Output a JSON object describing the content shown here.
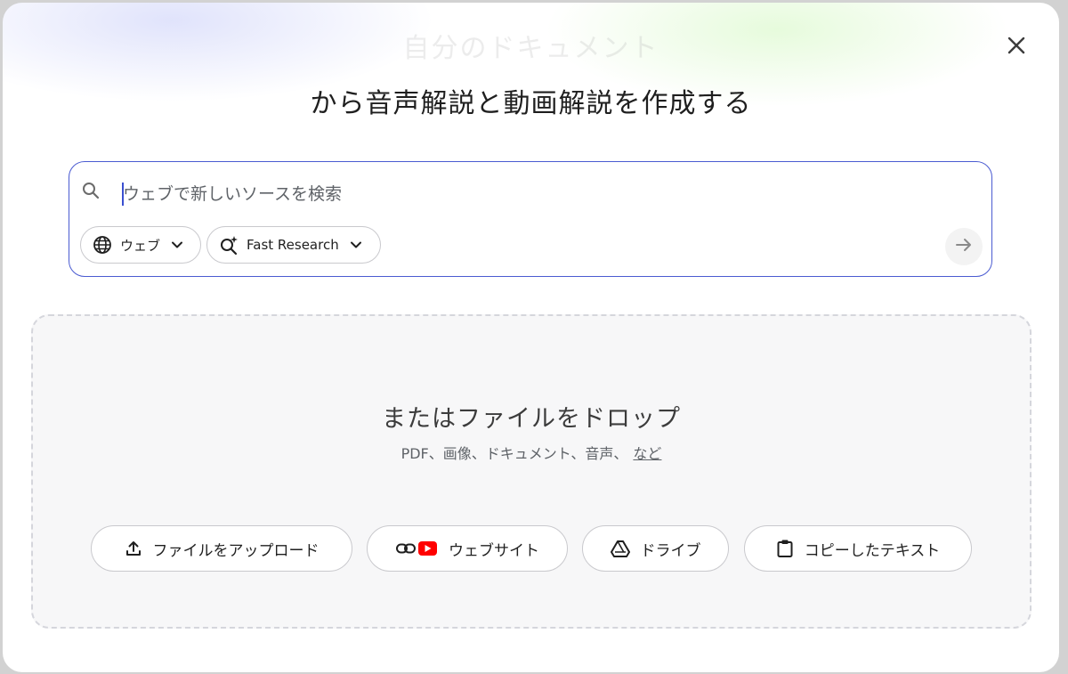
{
  "background_title": "自分のドキュメント",
  "dialog": {
    "title": "から音声解説と動画解説を作成する",
    "close_icon": "close-icon"
  },
  "search": {
    "placeholder": "ウェブで新しいソースを検索",
    "value": "",
    "source_chip": {
      "label": "ウェブ",
      "icon": "globe-icon"
    },
    "mode_chip": {
      "label": "Fast Research",
      "icon": "search-sparkle-icon"
    },
    "submit_icon": "arrow-right-icon"
  },
  "dropzone": {
    "title": "またはファイルをドロップ",
    "subtitle": "PDF、画像、ドキュメント、音声、",
    "more_link": "など",
    "buttons": [
      {
        "label": "ファイルをアップロード",
        "icon": "upload-icon"
      },
      {
        "label": "ウェブサイト",
        "icon": "link-youtube-icon"
      },
      {
        "label": "ドライブ",
        "icon": "drive-icon"
      },
      {
        "label": "コピーしたテキスト",
        "icon": "clipboard-icon"
      }
    ]
  },
  "colors": {
    "accent": "#4a5bd1",
    "youtube_red": "#ff0000",
    "dropzone_bg": "#f7f7f8"
  }
}
